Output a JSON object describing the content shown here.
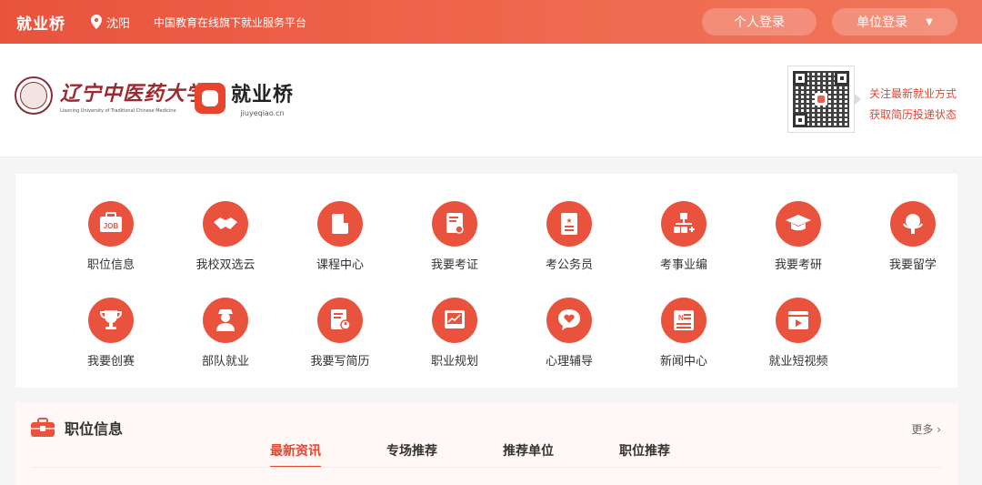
{
  "topbar": {
    "brand": "就业桥",
    "location": "沈阳",
    "slogan": "中国教育在线旗下就业服务平台",
    "personal_login": "个人登录",
    "unit_login": "单位登录",
    "colors": {
      "accent": "#e9533e"
    }
  },
  "header": {
    "university_name": "辽宁中医药大学",
    "university_en": "Liaoning University of Traditional Chinese Medicine",
    "jyq_name": "就业桥",
    "jyq_domain": "jiuyeqiao.cn",
    "qr_note_line1": "关注最新就业方式",
    "qr_note_line2": "获取简历投递状态"
  },
  "services": [
    {
      "label": "职位信息",
      "icon": "job-icon"
    },
    {
      "label": "我校双选云",
      "icon": "handshake-icon"
    },
    {
      "label": "课程中心",
      "icon": "book-icon"
    },
    {
      "label": "我要考证",
      "icon": "certificate-icon"
    },
    {
      "label": "考公务员",
      "icon": "civil-exam-icon"
    },
    {
      "label": "考事业编",
      "icon": "org-chart-icon"
    },
    {
      "label": "我要考研",
      "icon": "graduation-cap-icon"
    },
    {
      "label": "我要留学",
      "icon": "globe-icon"
    },
    {
      "label": "我要创赛",
      "icon": "trophy-icon"
    },
    {
      "label": "部队就业",
      "icon": "soldier-icon"
    },
    {
      "label": "我要写简历",
      "icon": "resume-icon"
    },
    {
      "label": "职业规划",
      "icon": "chart-board-icon"
    },
    {
      "label": "心理辅导",
      "icon": "heart-chat-icon"
    },
    {
      "label": "新闻中心",
      "icon": "newspaper-icon"
    },
    {
      "label": "就业短视频",
      "icon": "video-icon"
    }
  ],
  "jobs": {
    "title": "职位信息",
    "more": "更多",
    "tabs": [
      "最新资讯",
      "专场推荐",
      "推荐单位",
      "职位推荐"
    ]
  }
}
